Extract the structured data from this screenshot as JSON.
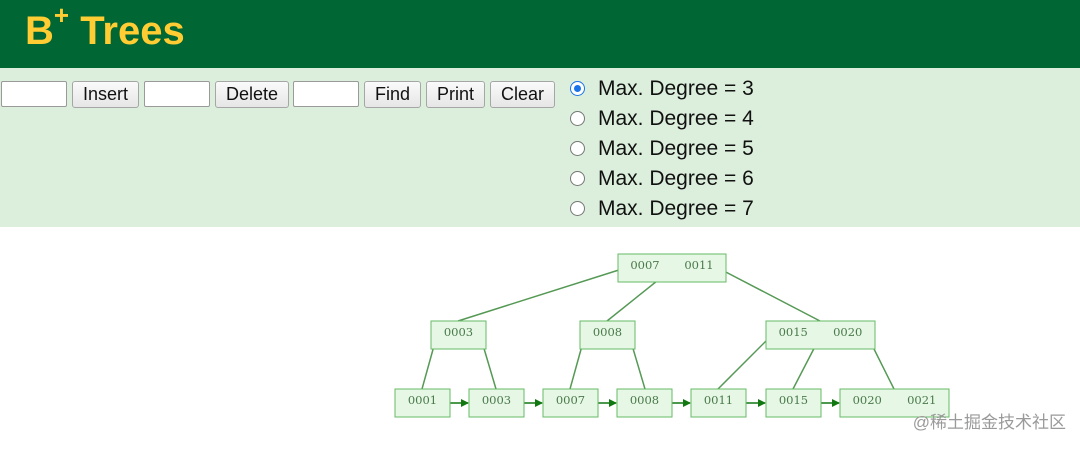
{
  "header": {
    "title_main": "B",
    "title_sup": "+",
    "title_rest": " Trees"
  },
  "controls": {
    "insert_input": {
      "value": "",
      "placeholder": ""
    },
    "insert_label": "Insert",
    "delete_input": {
      "value": "",
      "placeholder": ""
    },
    "delete_label": "Delete",
    "find_input": {
      "value": "",
      "placeholder": ""
    },
    "find_label": "Find",
    "print_label": "Print",
    "clear_label": "Clear",
    "degree_options": [
      {
        "label": "Max. Degree = 3",
        "checked": true
      },
      {
        "label": "Max. Degree = 4",
        "checked": false
      },
      {
        "label": "Max. Degree = 5",
        "checked": false
      },
      {
        "label": "Max. Degree = 6",
        "checked": false
      },
      {
        "label": "Max. Degree = 7",
        "checked": false
      }
    ]
  },
  "tree": {
    "root": {
      "keys": [
        "0007",
        "0011"
      ]
    },
    "internal": [
      {
        "keys": [
          "0003"
        ]
      },
      {
        "keys": [
          "0008"
        ]
      },
      {
        "keys": [
          "0015",
          "0020"
        ]
      }
    ],
    "leaves": [
      {
        "keys": [
          "0001"
        ]
      },
      {
        "keys": [
          "0003"
        ]
      },
      {
        "keys": [
          "0007"
        ]
      },
      {
        "keys": [
          "0008"
        ]
      },
      {
        "keys": [
          "0011"
        ]
      },
      {
        "keys": [
          "0015"
        ]
      },
      {
        "keys": [
          "0020",
          "0021"
        ]
      }
    ]
  },
  "colors": {
    "header_bg": "#006633",
    "title_color": "#ffcc33",
    "control_bg": "#dcefdc",
    "node_fill": "#e6f7e6",
    "node_stroke": "#66bb66",
    "edge_color": "#559955",
    "arrow_color": "#117711"
  },
  "watermark": "@稀土掘金技术社区"
}
